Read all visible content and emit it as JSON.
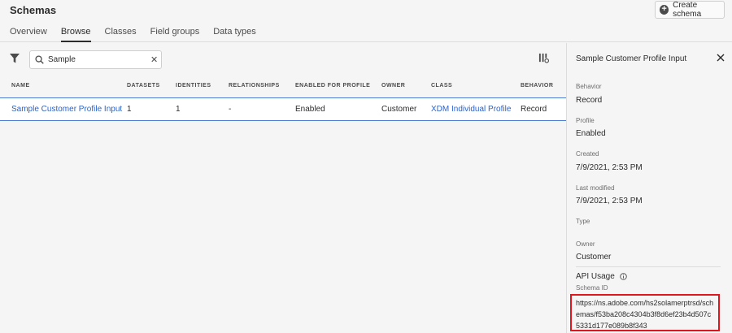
{
  "header": {
    "title": "Schemas",
    "tabs": [
      {
        "label": "Overview"
      },
      {
        "label": "Browse"
      },
      {
        "label": "Classes"
      },
      {
        "label": "Field groups"
      },
      {
        "label": "Data types"
      }
    ],
    "active_tab": "Browse",
    "create_label": "Create schema"
  },
  "toolbar": {
    "search_value": "Sample",
    "clear_glyph": "✕"
  },
  "table": {
    "columns": [
      "NAME",
      "DATASETS",
      "IDENTITIES",
      "RELATIONSHIPS",
      "ENABLED FOR PROFILE",
      "OWNER",
      "CLASS",
      "BEHAVIOR"
    ],
    "rows": [
      [
        "Sample Customer Profile Input",
        "1",
        "1",
        "-",
        "Enabled",
        "Customer",
        "XDM Individual Profile",
        "Record"
      ]
    ]
  },
  "panel": {
    "title": "Sample Customer Profile Input",
    "fields": [
      {
        "label": "Behavior",
        "value": "Record"
      },
      {
        "label": "Profile",
        "value": "Enabled"
      },
      {
        "label": "Created",
        "value": "7/9/2021, 2:53 PM"
      },
      {
        "label": "Last modified",
        "value": "7/9/2021, 2:53 PM"
      },
      {
        "label": "Type",
        "value": ""
      },
      {
        "label": "Owner",
        "value": "Customer"
      }
    ],
    "api_usage_title": "API Usage",
    "schema_id_label": "Schema ID",
    "schema_id": "https://ns.adobe.com/hs2solamerptrsd/schemas/f53ba208c4304b3f8d6ef23b4d507c5331d177e089b8f343"
  },
  "colors": {
    "link": "#2d62c6",
    "selection_border": "#4a7bd0",
    "highlight_box": "#e0161e"
  }
}
